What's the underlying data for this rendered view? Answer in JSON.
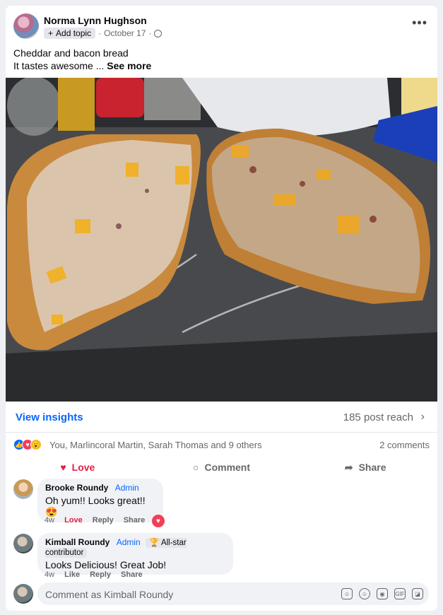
{
  "post": {
    "author": "Norma Lynn Hughson",
    "add_topic": "Add topic",
    "date": "October 17",
    "separator": "·",
    "caption_line1": "Cheddar and bacon bread",
    "caption_line2": "It tastes awesome ...",
    "see_more": "See more",
    "image_alt": "Cheddar and bacon bread cut in half on a marble counter"
  },
  "insights": {
    "view": "View insights",
    "reach": "185 post reach"
  },
  "reactions": {
    "names": "You, Marlincoral Martin, Sarah Thomas and 9 others",
    "comments": "2 comments"
  },
  "actions": {
    "love": "Love",
    "comment": "Comment",
    "share": "Share"
  },
  "comments": [
    {
      "name": "Brooke Roundy",
      "role": "Admin",
      "text": "Oh yum!! Looks great!! 😍",
      "time": "4w",
      "like": "Love",
      "reply": "Reply",
      "share": "Share"
    },
    {
      "name": "Kimball Roundy",
      "role": "Admin",
      "badge": "All-star contributor",
      "text": "Looks Delicious! Great Job!",
      "time": "4w",
      "like": "Like",
      "reply": "Reply",
      "share": "Share"
    }
  ],
  "composer": {
    "placeholder": "Comment as Kimball Roundy"
  },
  "colors": {
    "accent": "#0866ff",
    "love": "#e41e3f",
    "muted": "#65676b"
  }
}
